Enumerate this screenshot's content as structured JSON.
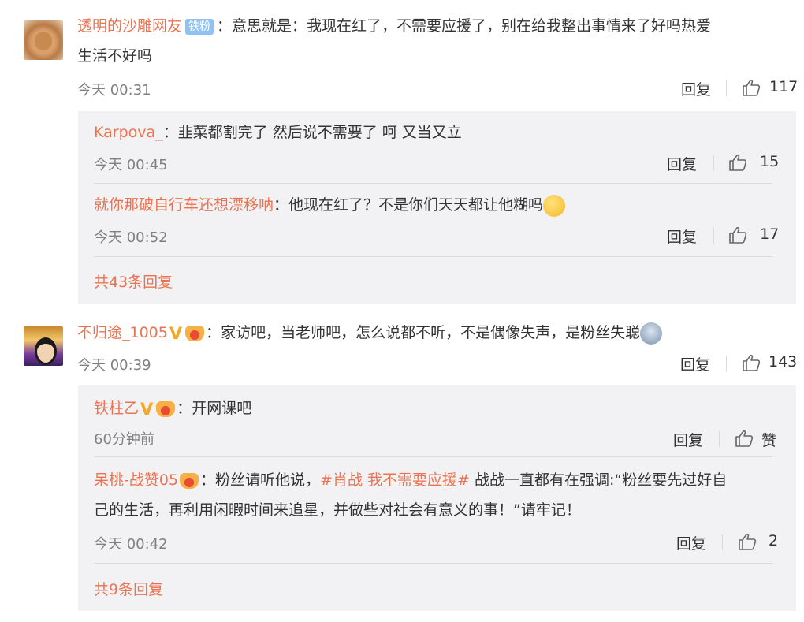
{
  "comments": [
    {
      "author": "透明的沙雕网友",
      "badge": "铁粉",
      "text": "：意思就是：我现在红了，不需要应援了，别在给我整出事情来了好吗热爱",
      "text_line2": "生活不好吗",
      "time": "今天 00:31",
      "reply_label": "回复",
      "likes": "117",
      "replies": [
        {
          "author": "Karpova_",
          "text": "：韭菜都割完了 然后说不需要了 呵 又当又立",
          "time": "今天 00:45",
          "reply_label": "回复",
          "likes": "15"
        },
        {
          "author": "就你那破自行车还想漂移呐",
          "text": "：他现在红了？不是你们天天都让他糊吗",
          "time": "今天 00:52",
          "reply_label": "回复",
          "likes": "17"
        }
      ],
      "more_replies": "共43条回复"
    },
    {
      "author": "不归途_1005",
      "text": "：家访吧，当老师吧，怎么说都不听，不是偶像失声，是粉丝失聪",
      "time": "今天 00:39",
      "reply_label": "回复",
      "likes": "143",
      "replies": [
        {
          "author": "铁柱乙",
          "text": "：开网课吧",
          "time": "60分钟前",
          "reply_label": "回复",
          "likes": "赞"
        },
        {
          "author": "呆桃-战赞05",
          "text_prefix": "：粉丝请听他说，",
          "topic": "#肖战 我不需要应援#",
          "text_suffix": " 战战一直都有在强调:“粉丝要先过好自",
          "text_line2": "己的生活，再利用闲暇时间来追星，并做些对社会有意义的事！”请牢记！",
          "time": "今天 00:42",
          "reply_label": "回复",
          "likes": "2"
        }
      ],
      "more_replies": "共9条回复"
    }
  ],
  "icons": {
    "like": "thumbs-up-icon",
    "vip": "v-badge-icon",
    "fan": "crown-fan-badge-icon",
    "emoji_shh": "shush-emoji-icon",
    "emoji_dog": "husky-emoji-icon"
  },
  "colors": {
    "name": "#eb7350",
    "badge": "#8fc2f0",
    "reply_bg": "#f2f2f5"
  }
}
